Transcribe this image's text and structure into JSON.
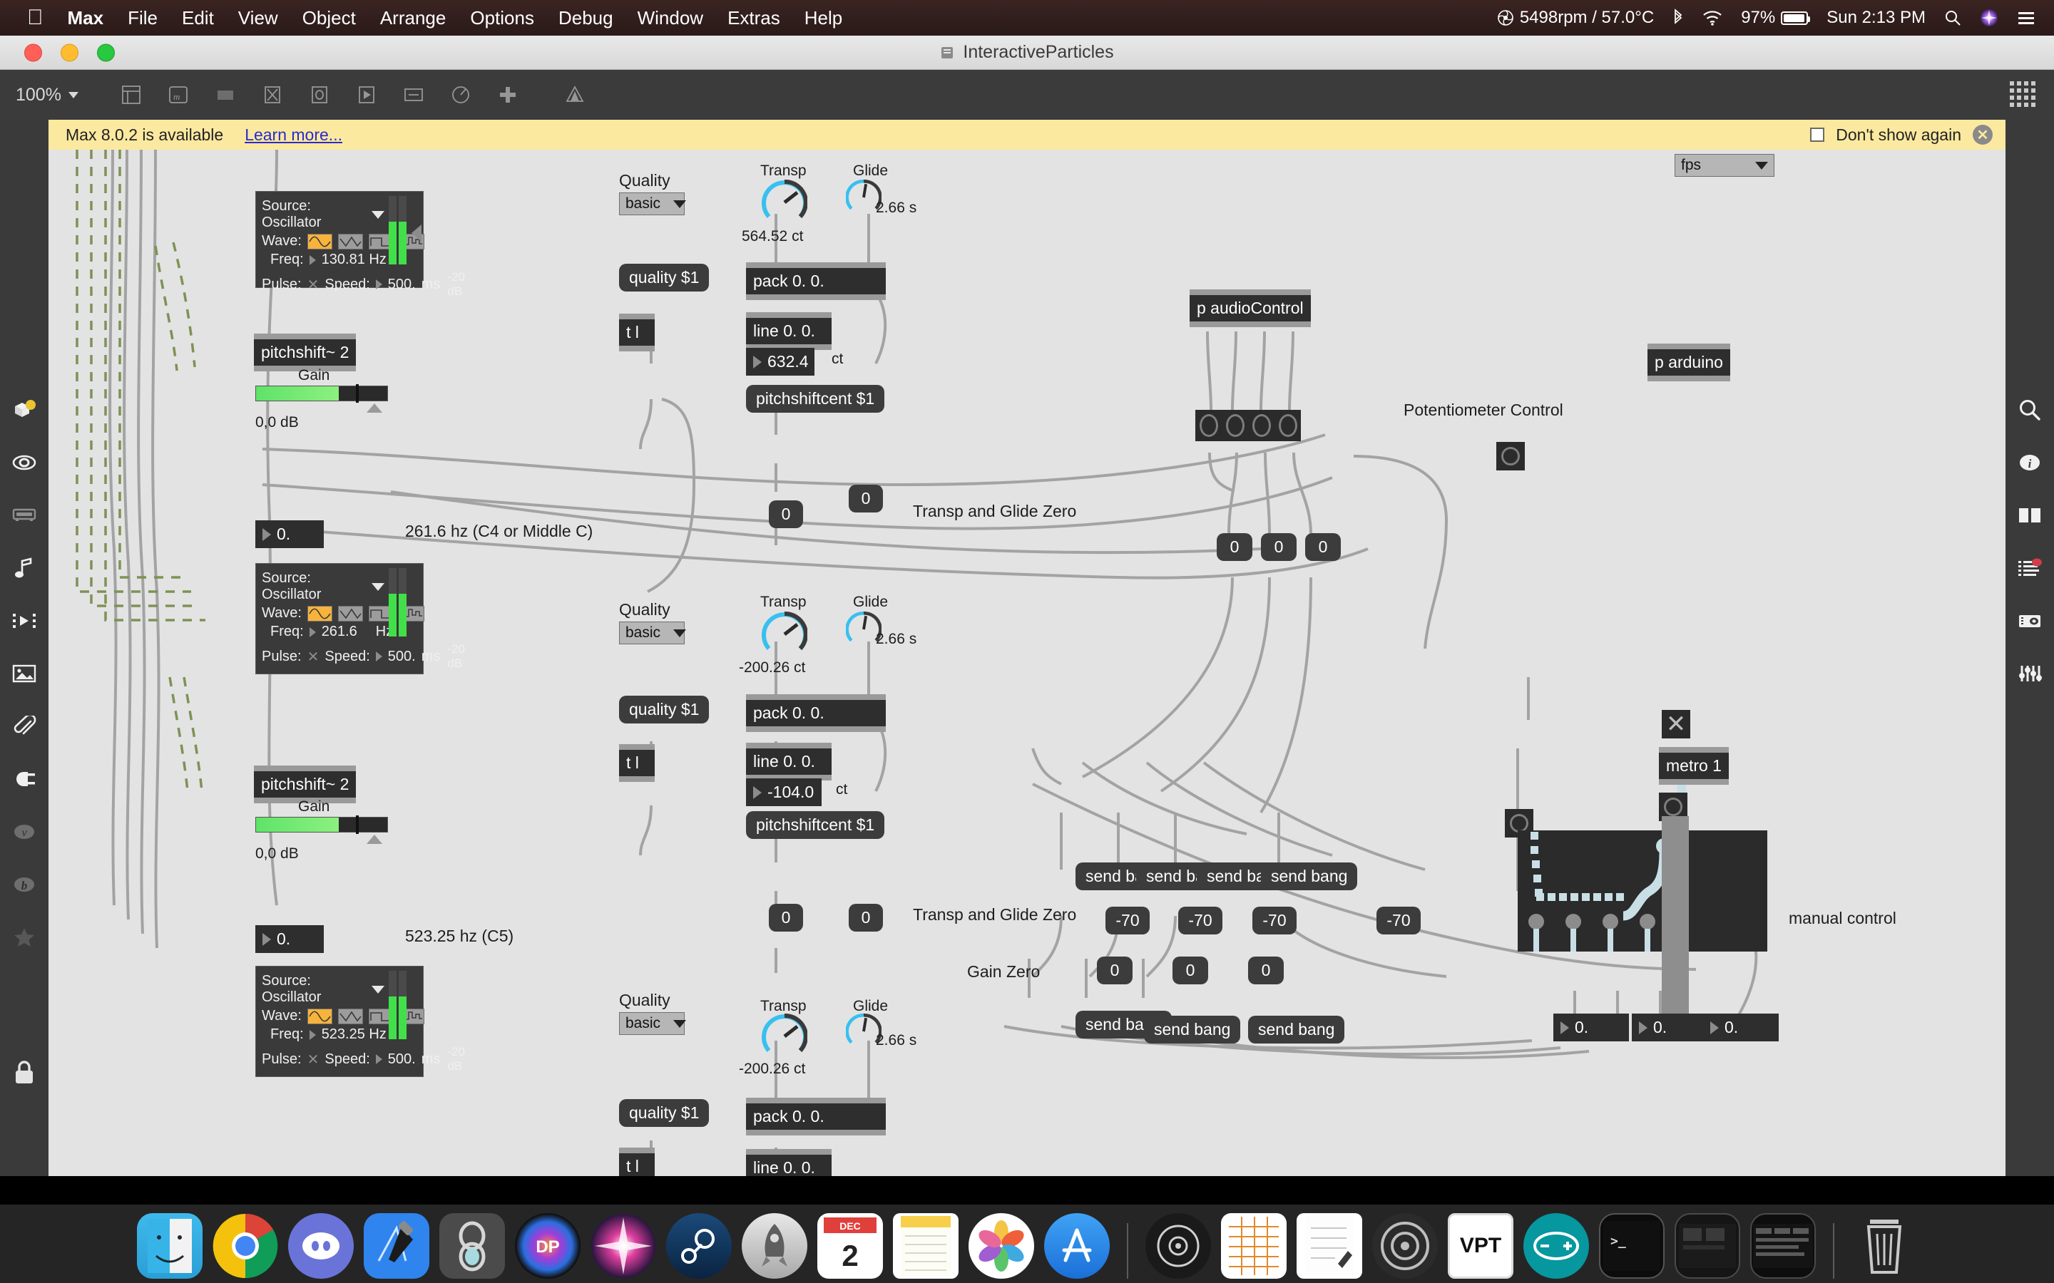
{
  "menubar": {
    "apple": "apple-logo",
    "items": [
      "Max",
      "File",
      "Edit",
      "View",
      "Object",
      "Arrange",
      "Options",
      "Debug",
      "Window",
      "Extras",
      "Help"
    ],
    "status": {
      "fan": "5498rpm / 57.0°C",
      "bluetooth": "bluetooth-icon",
      "wifi": "wifi-icon",
      "battery_pct": "97%",
      "clock": "Sun 2:13 PM",
      "spotlight": "search-icon",
      "siri": "siri-icon",
      "controlcenter": "list-icon"
    }
  },
  "window": {
    "title": "InteractiveParticles"
  },
  "toolbar": {
    "zoom": "100%",
    "icons": [
      "inspector-icon",
      "comment-icon",
      "bpatcher-icon",
      "message-icon",
      "object-icon",
      "toggle-icon",
      "button-icon",
      "number-icon",
      "dial-icon",
      "add-icon",
      "presentation-icon"
    ],
    "grid": "grid-icon"
  },
  "notice": {
    "text": "Max 8.0.2 is available",
    "link": "Learn more...",
    "dont_show": "Don't show again",
    "close": "close-icon"
  },
  "sidebar_left": [
    "package-icon",
    "eye-icon",
    "keyboard-icon",
    "music-note-icon",
    "video-icon",
    "image-icon",
    "clip-icon",
    "plug-icon",
    "vimeo-icon",
    "bold-b-icon",
    "star-icon"
  ],
  "sidebar_right": [
    "search-icon",
    "info-icon",
    "panel-icon",
    "console-icon",
    "snapshot-icon",
    "sliders-icon"
  ],
  "patch": {
    "fps_menu": "fps",
    "voices": [
      {
        "note_label": "",
        "note_num": "0.",
        "osc": {
          "source": "Source: Oscillator",
          "wave_label": "Wave:",
          "waves": [
            "sine",
            "triangle",
            "square",
            "pulse"
          ],
          "wave_selected": 0,
          "freq_label": "Freq:",
          "freq": "130.81 Hz",
          "pulse_label": "Pulse:",
          "speed_label": "Speed:",
          "speed": "500.",
          "ms": "ms",
          "db": "-20 dB"
        },
        "pitchshift": "pitchshift~ 2",
        "gain_label": "Gain",
        "gain_value": "0,0 dB",
        "quality_label": "Quality",
        "quality_menu": "basic",
        "quality_msg": "quality $1",
        "trigger": "t l",
        "transp_label": "Transp",
        "transp_value": "564.52 ct",
        "glide_label": "Glide",
        "glide_value": "2.66 s",
        "pack": "pack 0. 0.",
        "line": "line 0. 0.",
        "cents": "632.4",
        "ct": "ct",
        "pitchshiftcent": "pitchshiftcent $1"
      },
      {
        "note_label": "261.6 hz (C4 or Middle C)",
        "note_num": "0.",
        "osc": {
          "source": "Source: Oscillator",
          "wave_label": "Wave:",
          "waves": [
            "sine",
            "triangle",
            "square",
            "pulse"
          ],
          "wave_selected": 0,
          "freq_label": "Freq:",
          "freq": "261.6",
          "freq_unit": "Hz",
          "pulse_label": "Pulse:",
          "speed_label": "Speed:",
          "speed": "500.",
          "ms": "ms",
          "db": "-20 dB"
        },
        "pitchshift": "pitchshift~ 2",
        "gain_label": "Gain",
        "gain_value": "0,0 dB",
        "quality_label": "Quality",
        "quality_menu": "basic",
        "quality_msg": "quality $1",
        "trigger": "t l",
        "transp_label": "Transp",
        "transp_value": "-200.26 ct",
        "glide_label": "Glide",
        "glide_value": "2.66 s",
        "pack": "pack 0. 0.",
        "line": "line 0. 0.",
        "cents": "-104.0",
        "ct": "ct",
        "pitchshiftcent": "pitchshiftcent $1"
      },
      {
        "note_label": "523.25 hz (C5)",
        "note_num": "0.",
        "osc": {
          "source": "Source: Oscillator",
          "wave_label": "Wave:",
          "waves": [
            "sine",
            "triangle",
            "square",
            "pulse"
          ],
          "wave_selected": 0,
          "freq_label": "Freq:",
          "freq": "523.25 Hz",
          "pulse_label": "Pulse:",
          "speed_label": "Speed:",
          "speed": "500.",
          "ms": "ms",
          "db": "-20 dB"
        },
        "quality_label": "Quality",
        "quality_menu": "basic",
        "quality_msg": "quality $1",
        "trigger": "t l",
        "transp_label": "Transp",
        "transp_value": "-200.26 ct",
        "glide_label": "Glide",
        "glide_value": "2.66 s",
        "pack": "pack 0. 0.",
        "line": "line 0. 0."
      }
    ],
    "comments": {
      "transp_glide_zero_1": "Transp and Glide Zero",
      "transp_glide_zero_2": "Transp and Glide Zero",
      "gain_zero": "Gain Zero",
      "potentiometer_control": "Potentiometer Control",
      "manual_control": "manual control"
    },
    "subpatchers": {
      "audio_control": "p audioControl",
      "arduino": "p arduino"
    },
    "pot_values": [
      "0",
      "0",
      "0"
    ],
    "ints_mid": [
      "0",
      "0"
    ],
    "ints_low": [
      "0",
      "0"
    ],
    "send_bangs_row1": [
      "send bang",
      "send bang",
      "send bang",
      "send bang"
    ],
    "neg70_row": [
      "-70",
      "-70",
      "-70",
      "-70"
    ],
    "zero_row": [
      "0",
      "0",
      "0"
    ],
    "send_bangs_row2": [
      "send bang",
      "send bang",
      "send bang"
    ],
    "metro": "metro 1",
    "floats_out": [
      "0.",
      "0.",
      "0."
    ]
  },
  "dock": {
    "apps": [
      "Finder",
      "Chrome",
      "Discord",
      "Xcode",
      "Max",
      "DP",
      "Siri",
      "Steam",
      "Launchpad",
      "Calendar",
      "Notes",
      "Photos",
      "App Store",
      "Unity",
      "Arduino",
      "Terminal",
      "VPT",
      "Files",
      "Video",
      "Editor",
      "Trash"
    ]
  },
  "colors": {
    "accent_orange": "#f7b33c",
    "dial_blue": "#38c0ef",
    "wire_gray": "#9a9a9a",
    "signal_wire": "#c9dfe6",
    "notice_bg": "#fbe9a0",
    "canvas_bg": "#e3e3e3"
  }
}
